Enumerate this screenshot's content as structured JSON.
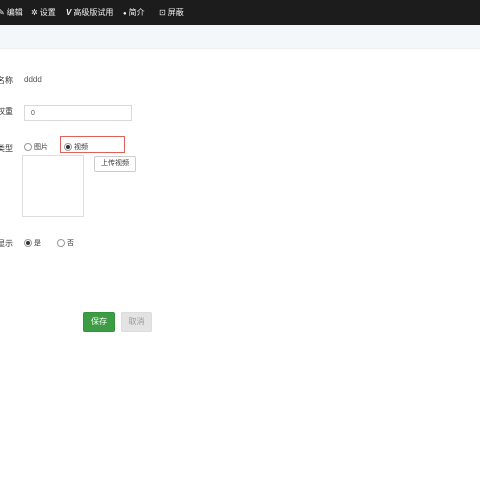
{
  "nav": {
    "items": [
      {
        "icon": "edit-icon",
        "glyph": "✎",
        "label": "编辑"
      },
      {
        "icon": "gear-icon",
        "glyph": "✲",
        "label": "设置"
      },
      {
        "icon": "v-icon",
        "glyph": "V",
        "label": "高级版试用"
      },
      {
        "icon": "user-icon",
        "glyph": "●",
        "label": "简介"
      },
      {
        "icon": "lock-icon",
        "glyph": "⊡",
        "label": "屏蔽"
      }
    ]
  },
  "form": {
    "name": {
      "label": "名称",
      "value": "dddd"
    },
    "weight": {
      "label": "权重",
      "value": "0"
    },
    "type": {
      "label": "类型",
      "options": [
        {
          "label": "图片",
          "checked": false
        },
        {
          "label": "视频",
          "checked": true
        }
      ],
      "upload_label": "上传视频"
    },
    "display": {
      "label": "显示",
      "options": [
        {
          "label": "是",
          "checked": true
        },
        {
          "label": "否",
          "checked": false
        }
      ]
    }
  },
  "actions": {
    "save_label": "保存",
    "cancel_label": "取消"
  },
  "colors": {
    "topbar": "#1c1c1c",
    "save": "#3d9d44",
    "highlight": "#e0605a"
  }
}
